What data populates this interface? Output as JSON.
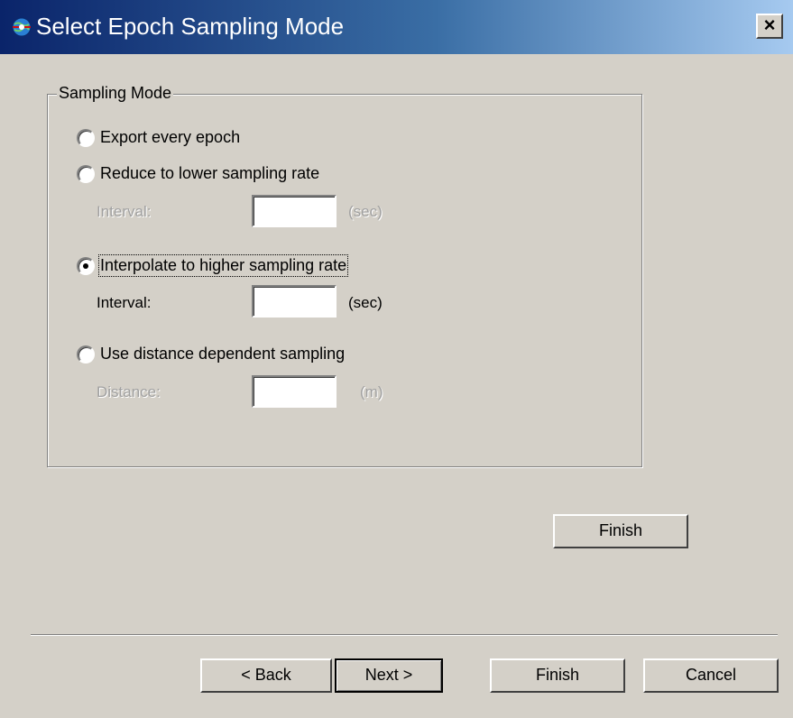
{
  "window": {
    "title": "Select Epoch Sampling Mode",
    "close_label": "×",
    "icon": "globe-icon"
  },
  "group": {
    "legend": "Sampling Mode",
    "options": [
      {
        "label": "Export every epoch",
        "selected": false
      },
      {
        "label": "Reduce to lower sampling rate",
        "selected": false
      },
      {
        "label": "Interpolate to higher sampling rate",
        "selected": true
      },
      {
        "label": "Use distance dependent sampling",
        "selected": false
      }
    ],
    "fields": [
      {
        "label": "Interval:",
        "value": "",
        "unit": "(sec)",
        "enabled": false
      },
      {
        "label": "Interval:",
        "value": "",
        "unit": "(sec)",
        "enabled": true
      },
      {
        "label": "Distance:",
        "value": "",
        "unit": "(m)",
        "enabled": false
      }
    ]
  },
  "buttons": {
    "finish_inner": "Finish",
    "back": "< Back",
    "next": "Next >",
    "finish": "Finish",
    "cancel": "Cancel"
  },
  "colors": {
    "title_start": "#0a246a",
    "title_end": "#a6caf0",
    "face": "#d4d0c8"
  }
}
